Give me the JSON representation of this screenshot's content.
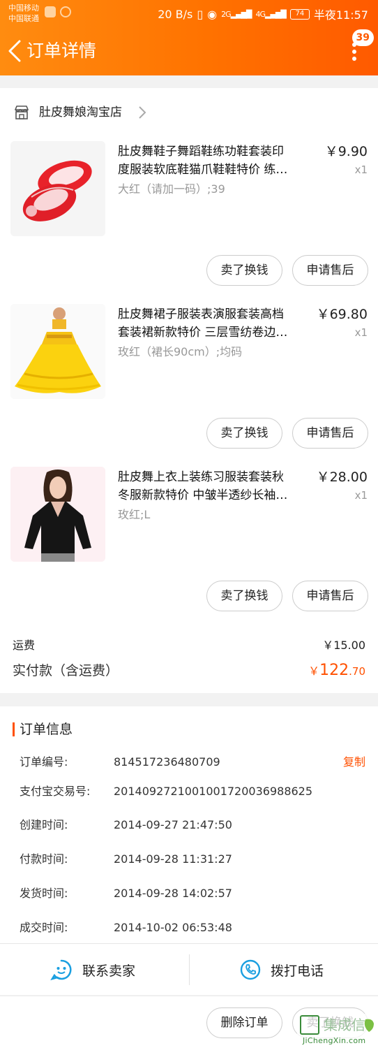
{
  "status_bar": {
    "carrier1": "中国移动",
    "carrier2": "中国联通",
    "speed": "20 B/s",
    "battery": "74",
    "time": "半夜11:57",
    "signal1": "2G",
    "signal2": "4G"
  },
  "header": {
    "title": "订单详情",
    "badge": "39"
  },
  "shop": {
    "name": "肚皮舞娘淘宝店"
  },
  "items": [
    {
      "title_line1": "肚皮舞鞋子舞蹈鞋练功鞋套装印",
      "title_line2": "度服装软底鞋猫爪鞋鞋特价 练…",
      "sku": "大红（请加一码）;39",
      "price": "￥9.90",
      "qty": "x1",
      "btn_sell": "卖了换钱",
      "btn_after": "申请售后"
    },
    {
      "title_line1": "肚皮舞裙子服装表演服套装高档",
      "title_line2": "套装裙新款特价 三层雪纺卷边…",
      "sku": "玫红（裙长90cm）;均码",
      "price": "￥69.80",
      "qty": "x1",
      "btn_sell": "卖了换钱",
      "btn_after": "申请售后"
    },
    {
      "title_line1": "肚皮舞上衣上装练习服装套装秋",
      "title_line2": "冬服新款特价 中皱半透纱长袖…",
      "sku": "玫红;L",
      "price": "￥28.00",
      "qty": "x1",
      "btn_sell": "卖了换钱",
      "btn_after": "申请售后"
    }
  ],
  "summary": {
    "freight_label": "运费",
    "freight_value": "￥15.00",
    "paid_label": "实付款（含运费）",
    "paid_currency": "￥",
    "paid_int": "122",
    "paid_dec": ".70"
  },
  "order_info": {
    "title": "订单信息",
    "copy_label": "复制",
    "rows": [
      {
        "key": "订单编号:",
        "value": "814517236480709"
      },
      {
        "key": "支付宝交易号:",
        "value": "2014092721001001720036988625"
      },
      {
        "key": "创建时间:",
        "value": "2014-09-27 21:47:50"
      },
      {
        "key": "付款时间:",
        "value": "2014-09-28 11:31:27"
      },
      {
        "key": "发货时间:",
        "value": "2014-09-28 14:02:57"
      },
      {
        "key": "成交时间:",
        "value": "2014-10-02 06:53:48"
      }
    ]
  },
  "contact": {
    "seller": "联系卖家",
    "phone": "拨打电话"
  },
  "bottom": {
    "delete": "删除订单",
    "sell": "卖了换钱"
  },
  "watermark": {
    "cn": "集成信",
    "url": "JiChengXin.com"
  },
  "colors": {
    "accent": "#ff5000",
    "header": "#ff7200",
    "link": "#1a9fe0"
  },
  "icons": {
    "back": "chevron-left-icon",
    "more": "more-vertical-icon",
    "shop": "shop-icon",
    "chat": "chat-bubble-icon",
    "phone": "phone-icon"
  }
}
